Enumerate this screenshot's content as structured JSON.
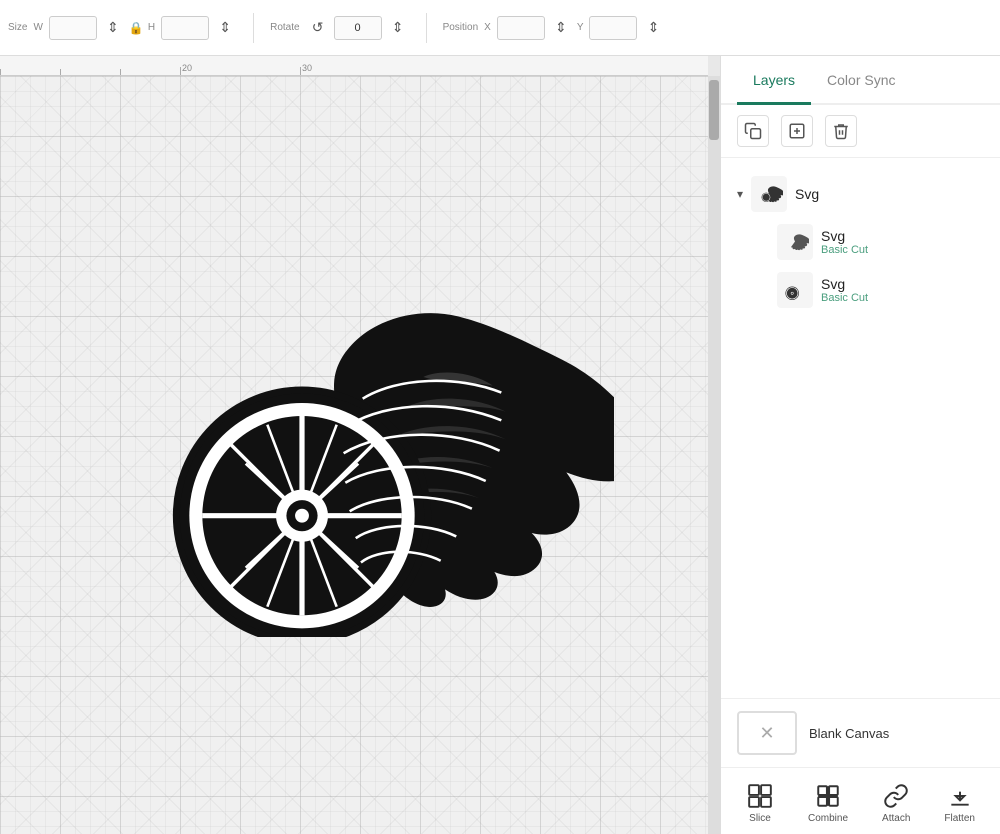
{
  "toolbar": {
    "size_label": "Size",
    "w_label": "W",
    "h_label": "H",
    "rotate_label": "Rotate",
    "position_label": "Position",
    "x_label": "X",
    "y_label": "Y",
    "w_value": "",
    "h_value": "",
    "rotate_value": "0",
    "x_value": "",
    "y_value": ""
  },
  "ruler": {
    "mark_20": "20",
    "mark_30": "30"
  },
  "right_panel": {
    "tabs": [
      {
        "id": "layers",
        "label": "Layers",
        "active": true
      },
      {
        "id": "color_sync",
        "label": "Color Sync",
        "active": false
      }
    ],
    "toolbar_icons": [
      "copy",
      "add_group",
      "delete"
    ],
    "layers": [
      {
        "id": "svg_group",
        "type": "group",
        "name": "Svg",
        "expanded": true,
        "children": [
          {
            "id": "svg_1",
            "name": "Svg",
            "sublabel": "Basic Cut"
          },
          {
            "id": "svg_2",
            "name": "Svg",
            "sublabel": "Basic Cut"
          }
        ]
      }
    ],
    "blank_canvas_label": "Blank Canvas",
    "action_buttons": [
      {
        "id": "slice",
        "label": "Slice",
        "icon": "⊠"
      },
      {
        "id": "combine",
        "label": "Combine",
        "icon": "⊞"
      },
      {
        "id": "attach",
        "label": "Attach",
        "icon": "🔗"
      },
      {
        "id": "flatten",
        "label": "Flatten",
        "icon": "⬇"
      }
    ]
  },
  "colors": {
    "accent": "#1a7a5e",
    "tab_active_border": "#1a7a5e",
    "layer_sub_text": "#4a9e7e"
  }
}
